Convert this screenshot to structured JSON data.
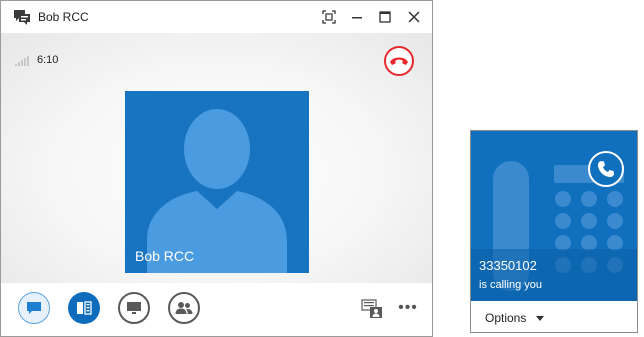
{
  "window": {
    "title": "Bob RCC",
    "controls": [
      "fullscreen-icon",
      "minimize-icon",
      "maximize-icon",
      "close-icon"
    ]
  },
  "call": {
    "duration": "6:10",
    "contact_name": "Bob RCC"
  },
  "toolbar": {
    "buttons": [
      "chat-icon",
      "call-controls-icon",
      "present-icon",
      "participants-icon"
    ],
    "more_label": "•••"
  },
  "incoming": {
    "number": "33350102",
    "status": "is calling you",
    "options_label": "Options"
  },
  "colors": {
    "accent": "#1874c1",
    "toast": "#1070bd",
    "hangup": "#e8282e"
  }
}
